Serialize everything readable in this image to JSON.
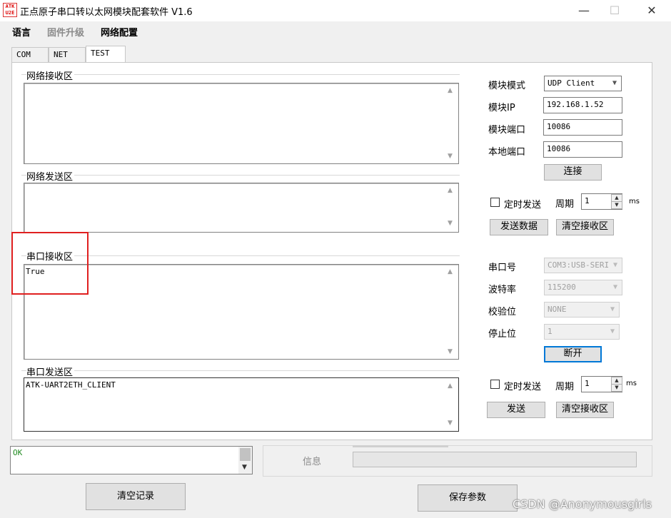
{
  "window": {
    "icon_text_top": "ATK",
    "icon_text_bottom": "U2E",
    "title": "正点原子串口转以太网模块配套软件 V1.6",
    "minimize_glyph": "—",
    "maximize_glyph": "☐",
    "close_glyph": "✕"
  },
  "menu": {
    "language": "语言",
    "firmware_upgrade": "固件升级",
    "network_config": "网络配置"
  },
  "tabs": [
    {
      "label": "COM"
    },
    {
      "label": "NET"
    },
    {
      "label": "TEST"
    }
  ],
  "network_receive": {
    "label": "网络接收区",
    "value": ""
  },
  "network_send": {
    "label": "网络发送区",
    "value": ""
  },
  "serial_receive": {
    "label": "串口接收区",
    "value": "True"
  },
  "serial_send": {
    "label": "串口发送区",
    "value": "ATK-UART2ETH_CLIENT"
  },
  "network_settings": {
    "module_mode_label": "模块模式",
    "module_mode_value": "UDP Client",
    "module_ip_label": "模块IP",
    "module_ip_value": "192.168.1.52",
    "module_port_label": "模块端口",
    "module_port_value": "10086",
    "local_port_label": "本地端口",
    "local_port_value": "10086",
    "connect_button": "连接",
    "timed_send_label": "定时发送",
    "period_label": "周期",
    "period_value": "1",
    "unit": "ms",
    "send_data_button": "发送数据",
    "clear_receive_button": "清空接收区"
  },
  "serial_settings": {
    "port_label": "串口号",
    "port_value": "COM3:USB-SERI",
    "baud_label": "波特率",
    "baud_value": "115200",
    "parity_label": "校验位",
    "parity_value": "NONE",
    "stop_label": "停止位",
    "stop_value": "1",
    "disconnect_button": "断开",
    "timed_send_label": "定时发送",
    "period_label": "周期",
    "period_value": "1",
    "unit": "ms",
    "send_button": "发送",
    "clear_receive_button": "清空接收区"
  },
  "log": {
    "value": "OK"
  },
  "info": {
    "label": "信息"
  },
  "bottom": {
    "clear_log_button": "清空记录",
    "save_params_button": "保存参数"
  },
  "watermark": "CSDN @Anonymousgirls",
  "colors": {
    "highlight_box": "#e02020",
    "log_text": "#228b22",
    "focus_border": "#0078d7"
  }
}
